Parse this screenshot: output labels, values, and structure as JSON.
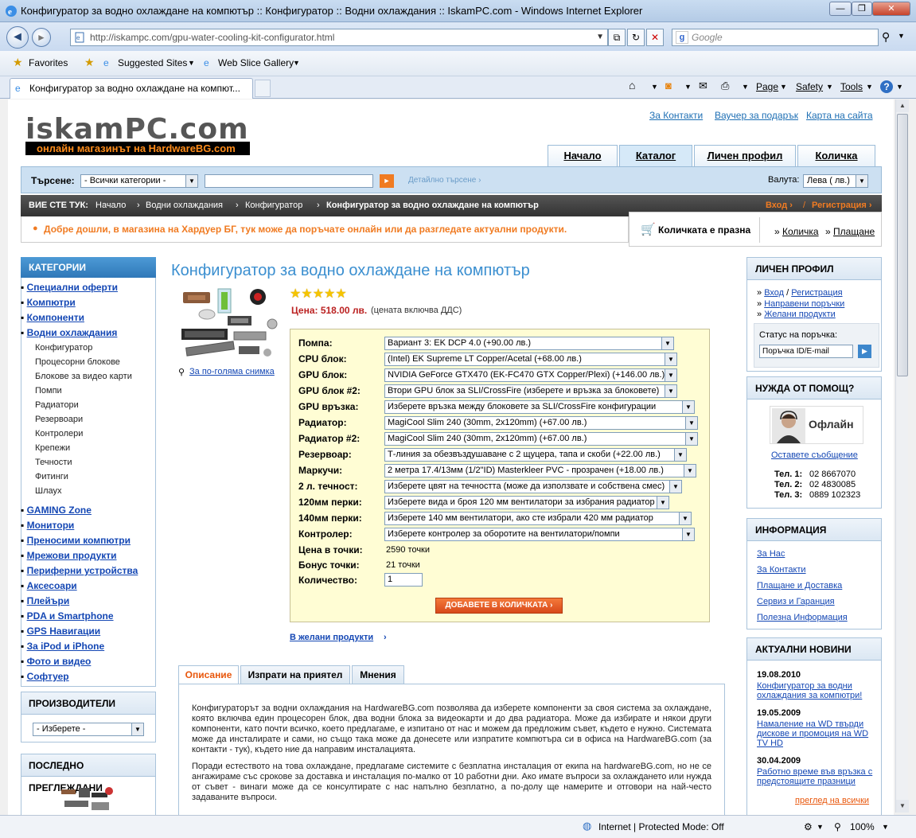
{
  "window": {
    "title": "Конфигуратор за водно охлаждане на компютър :: Конфигуратор :: Водни охлаждания :: IskamPC.com  - Windows Internet Explorer",
    "minimize": "—",
    "restore": "❐",
    "close": "✕"
  },
  "browser": {
    "back": "◄",
    "forward": "►",
    "url": "http://iskampc.com/gpu-water-cooling-kit-configurator.html",
    "search_placeholder": "Google",
    "favorites_label": "Favorites",
    "suggested_sites": "Suggested Sites",
    "web_slice": "Web Slice Gallery",
    "tab_title": "Конфигуратор за водно охлаждане на компют...",
    "cmd_page": "Page",
    "cmd_safety": "Safety",
    "cmd_tools": "Tools",
    "status_zone": "Internet | Protected Mode: Off",
    "zoom": "100%"
  },
  "site": {
    "logo_main": "iskam",
    "logo_pc": "PC",
    "logo_dom": ".com",
    "tagline": "онлайн магазинът на HardwareBG.com",
    "top_links": [
      "За Контакти",
      "Ваучер за подарък",
      "Карта на сайта"
    ],
    "main_tabs": [
      "Начало",
      "Каталог",
      "Личен профил",
      "Количка"
    ],
    "search_label": "Търсене:",
    "search_category": "- Всички категории -",
    "search_go": "►",
    "advanced_search": "Детайлно търсене",
    "currency_label": "Валута:",
    "currency_value": "Лева ( лв.)",
    "crumb_label": "ВИЕ СТЕ ТУК:",
    "crumbs": [
      "Начало",
      "Водни охлаждания",
      "Конфигуратор"
    ],
    "crumb_current": "Конфигуратор за водно охлаждане на компютър",
    "login": "Вход",
    "register": "Регистрация",
    "welcome": "Добре дошли, в магазина на Хардуер БГ, тук може да поръчате онлайн или да разгледате актуални продукти.",
    "cart_empty": "Количката е празна",
    "cart_link": "Количка",
    "pay_link": "Плащане"
  },
  "left": {
    "categories_title": "КАТЕГОРИИ",
    "cats_top": [
      "Специални оферти",
      "Компютри",
      "Компоненти",
      "Водни охлаждания"
    ],
    "subcats": [
      "Конфигуратор",
      "Процесорни блокове",
      "Блокове за видео карти",
      "Помпи",
      "Радиатори",
      "Резервоари",
      "Контролери",
      "Крепежи",
      "Течности",
      "Фитинги",
      "Шлаух"
    ],
    "cats_bottom": [
      "GAMING Zone",
      "Монитори",
      "Преносими компютри",
      "Мрежови продукти",
      "Периферни устройства",
      "Аксесоари",
      "Плейъри",
      "PDA и Smartphone",
      "GPS Навигации",
      "За iPod и iPhone",
      "Фото и видео",
      "Софтуер"
    ],
    "manufacturers_title": "ПРОИЗВОДИТЕЛИ",
    "manufacturers_select": "- Изберете -",
    "recent_title": "ПОСЛЕДНО ПРЕГЛЕЖДАНИ"
  },
  "product": {
    "title": "Конфигуратор за водно охлаждане на компютър",
    "rating": 5,
    "price_label": "Цена: 518.00 лв.",
    "price_note": "(цената включва ДДС)",
    "zoom_link": "За по-голяма снимка",
    "config": [
      {
        "label": "Помпа:",
        "value": "Вариант 3: EK DCP 4.0 (+90.00 лв.)"
      },
      {
        "label": "CPU блок:",
        "value": "(Intel) EK Supreme LT Copper/Acetal (+68.00 лв.)"
      },
      {
        "label": "GPU блок:",
        "value": "NVIDIA GeForce GTX470 (EK-FC470 GTX Copper/Plexi) (+146.00 лв.)"
      },
      {
        "label": "GPU блок #2:",
        "value": "Втори GPU блок за SLI/CrossFire (изберете и връзка за блоковете)"
      },
      {
        "label": "GPU връзка:",
        "value": "Изберете връзка между блоковете за SLI/CrossFire конфигурации"
      },
      {
        "label": "Радиатор:",
        "value": "MagiCool Slim 240 (30mm, 2x120mm) (+67.00 лв.)"
      },
      {
        "label": "Радиатор #2:",
        "value": "MagiCool Slim 240 (30mm, 2x120mm) (+67.00 лв.)"
      },
      {
        "label": "Резервоар:",
        "value": "Т-линия за обезвъздушаване с 2 щуцера, тапа и скоби (+22.00 лв.)"
      },
      {
        "label": "Маркучи:",
        "value": "2 метра 17.4/13мм (1/2\"ID) Masterkleer PVC - прозрачен (+18.00 лв.)"
      },
      {
        "label": "2 л. течност:",
        "value": "Изберете цвят на течността (може да използвате и собствена смес)"
      },
      {
        "label": "120мм перки:",
        "value": "Изберете вида и броя 120 мм вентилатори за избрания радиатор"
      },
      {
        "label": "140мм перки:",
        "value": "Изберете 140 мм вентилатори, ако сте избрали 420 мм радиатор"
      },
      {
        "label": "Контролер:",
        "value": "Изберете контролер за оборотите на вентилатори/помпи"
      }
    ],
    "points_label": "Цена в точки:",
    "points_value": "2590 точки",
    "bonus_label": "Бонус точки:",
    "bonus_value": "21 точки",
    "qty_label": "Количество:",
    "qty_value": "1",
    "add_to_cart": "ДОБАВЕТЕ В КОЛИЧКАТА",
    "wishlist": "В желани продукти",
    "tabs": [
      "Описание",
      "Изпрати на приятел",
      "Мнения"
    ],
    "desc_p1": "Конфигураторът за водни охлаждания на HardwareBG.com позволява да изберете компоненти за своя система за охлаждане, която включва един процесорен блок, два водни блока за видеокарти и до два радиатора. Може да избирате и някои други компоненти, като почти всичко, което предлагаме, е изпитано от нас и можем да предложим съвет, където е нужно. Системата може да инсталирате и сами, но също така може да донесете или изпратите компютъра си в офиса на HardwareBG.com (за контакти - тук), където ние да направим инсталацията.",
    "desc_p2": "Поради естеството на това охлаждане, предлагаме системите с безплатна инсталация от екипа на hardwareBG.com, но не се ангажираме със срокове за доставка и инсталация по-малко от 10 работни дни. Ако имате въпроси за охлаждането или нужда от съвет - винаги може да се консултирате с нас напълно безплатно, а по-долу ще намерите и отговори на най-често задаваните въпроси."
  },
  "right": {
    "profile_title": "ЛИЧЕН ПРОФИЛ",
    "login": "Вход",
    "register": "Регистрация",
    "orders": "Направени поръчки",
    "wishlist": "Желани продукти",
    "order_status_label": "Статус на поръчка:",
    "order_status_placeholder": "Поръчка ID/E-mail",
    "help_title": "НУЖДА ОТ ПОМОЩ?",
    "offline": "Офлайн",
    "leave_message": "Оставете съобщение",
    "tel1_label": "Тел. 1:",
    "tel1": "02 8667070",
    "tel2_label": "Тел. 2:",
    "tel2": "02 4830085",
    "tel3_label": "Тел. 3:",
    "tel3": "0889 102323",
    "info_title": "ИНФОРМАЦИЯ",
    "info_links": [
      "За Нас",
      "За Контакти",
      "Плащане и Доставка",
      "Сервиз и Гаранция",
      "Полезна Информация"
    ],
    "news_title": "АКТУАЛНИ НОВИНИ",
    "news": [
      {
        "date": "19.08.2010",
        "text": "Конфигуратор за водни охлаждания за компютри!"
      },
      {
        "date": "19.05.2009",
        "text": "Намаление на WD твърди дискове и промоция на WD TV HD"
      },
      {
        "date": "30.04.2009",
        "text": "Работно време във връзка с предстоящите празници"
      }
    ],
    "news_all": "преглед на всички"
  },
  "colors": {
    "accent": "#e8560b",
    "link": "#1447b4",
    "header_blue": "#2f78b8"
  }
}
